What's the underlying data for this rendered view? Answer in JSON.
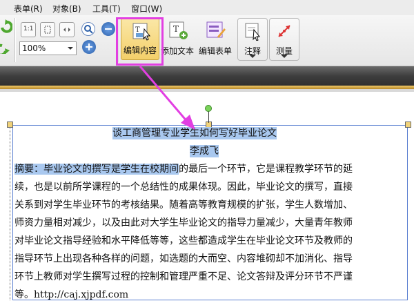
{
  "menu": {
    "items": [
      "表单(R)",
      "对象(B)",
      "工具(T)",
      "窗口(W)"
    ]
  },
  "toolbar": {
    "zoom_value": "100%",
    "edit_content_label": "编辑内容",
    "add_text_label": "添加文本",
    "edit_form_label": "编辑表单",
    "annotate_label": "注释",
    "measure_label": "测量",
    "page_1to1_label": "1:1"
  },
  "document": {
    "title": "谈工商管理专业学生如何写好毕业论文",
    "author": "李成飞",
    "abstract_prefix": "摘要：",
    "line1_highlighted": "毕业论文的撰写是学生在校期间",
    "line1_rest": "的最后一个环节，它是课程教学环节的延",
    "line2": "续，也是以前所学课程的一个总结性的成果体现。因此，毕业论文的撰写，直接",
    "line3": "关系到对学生毕业环节的考核结果。随着高等教育规模的扩张，学生人数增加、",
    "line4": "师资力量相对减少，以及由此对大学生毕业论文的指导力量减少，大量青年教师",
    "line5": "对毕业论文指导经验和水平降低等等，这些都造成学生在毕业论文环节及教师的",
    "line6": "指导环节上出现各种各样的问题，如选题的大而空、内容堆砌却不加消化、指导",
    "line7": "环节上教师对学生撰写过程的控制和管理严重不足、论文答辩及评分环节不严谨",
    "line8": "等。http://caj.xjpdf.com"
  },
  "colors": {
    "highlight": "#a9c8ef",
    "callout": "#e23fe2",
    "selection_border": "#5a7fd0"
  }
}
